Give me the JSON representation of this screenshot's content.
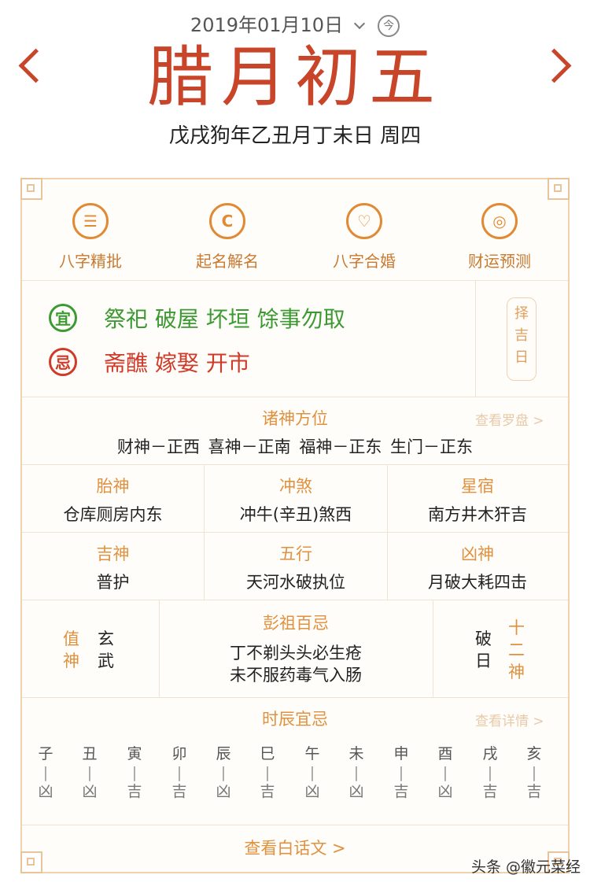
{
  "header": {
    "solar_date": "2019年01月10日",
    "today_icon": "今",
    "lunar_date": "腊月初五",
    "ganzhi": "戊戌狗年乙丑月丁未日  周四"
  },
  "services": [
    {
      "label": "八字精批",
      "icon": "☰"
    },
    {
      "label": "起名解名",
      "icon": "C"
    },
    {
      "label": "八字合婚",
      "icon": "♡"
    },
    {
      "label": "财运预测",
      "icon": "◎"
    }
  ],
  "yiji": {
    "yi_badge": "宜",
    "yi_text": "祭祀 破屋 坏垣 馀事勿取",
    "ji_badge": "忌",
    "ji_text": "斋醮 嫁娶 开市",
    "zeji_button": [
      "择",
      "吉",
      "日"
    ]
  },
  "gods_direction": {
    "title": "诸神方位",
    "link": "查看罗盘 >",
    "text": "财神－正西  喜神－正南  福神－正东  生门－正东"
  },
  "grid": [
    {
      "title": "胎神",
      "value": "仓库厕房内东"
    },
    {
      "title": "冲煞",
      "value": "冲牛(辛丑)煞西"
    },
    {
      "title": "星宿",
      "value": "南方井木犴吉"
    },
    {
      "title": "吉神",
      "value": "普护"
    },
    {
      "title": "五行",
      "value": "天河水破执位"
    },
    {
      "title": "凶神",
      "value": "月破大耗四击"
    }
  ],
  "zhishen": {
    "label": [
      "值",
      "神"
    ],
    "value": [
      "玄",
      "武"
    ]
  },
  "pengzu": {
    "title": "彭祖百忌",
    "line1": "丁不剃头头必生疮",
    "line2": "未不服药毒气入肠"
  },
  "twelve_gods": {
    "value": [
      "破",
      "日"
    ],
    "label": [
      "十",
      "二",
      "神"
    ]
  },
  "hours": {
    "title": "时辰宜忌",
    "link": "查看详情 >",
    "items": [
      {
        "branch": "子",
        "luck": "凶"
      },
      {
        "branch": "丑",
        "luck": "凶"
      },
      {
        "branch": "寅",
        "luck": "吉"
      },
      {
        "branch": "卯",
        "luck": "吉"
      },
      {
        "branch": "辰",
        "luck": "凶"
      },
      {
        "branch": "巳",
        "luck": "吉"
      },
      {
        "branch": "午",
        "luck": "凶"
      },
      {
        "branch": "未",
        "luck": "凶"
      },
      {
        "branch": "申",
        "luck": "吉"
      },
      {
        "branch": "酉",
        "luck": "凶"
      },
      {
        "branch": "戌",
        "luck": "吉"
      },
      {
        "branch": "亥",
        "luck": "吉"
      }
    ],
    "separator": "|"
  },
  "footer": {
    "baihua_link": "查看白话文 >",
    "watermark": "头条 @徽元菜经"
  },
  "colors": {
    "accent": "#c8452a",
    "gold": "#e0913f",
    "yi": "#3d9a33",
    "ji": "#cf3b2a"
  }
}
